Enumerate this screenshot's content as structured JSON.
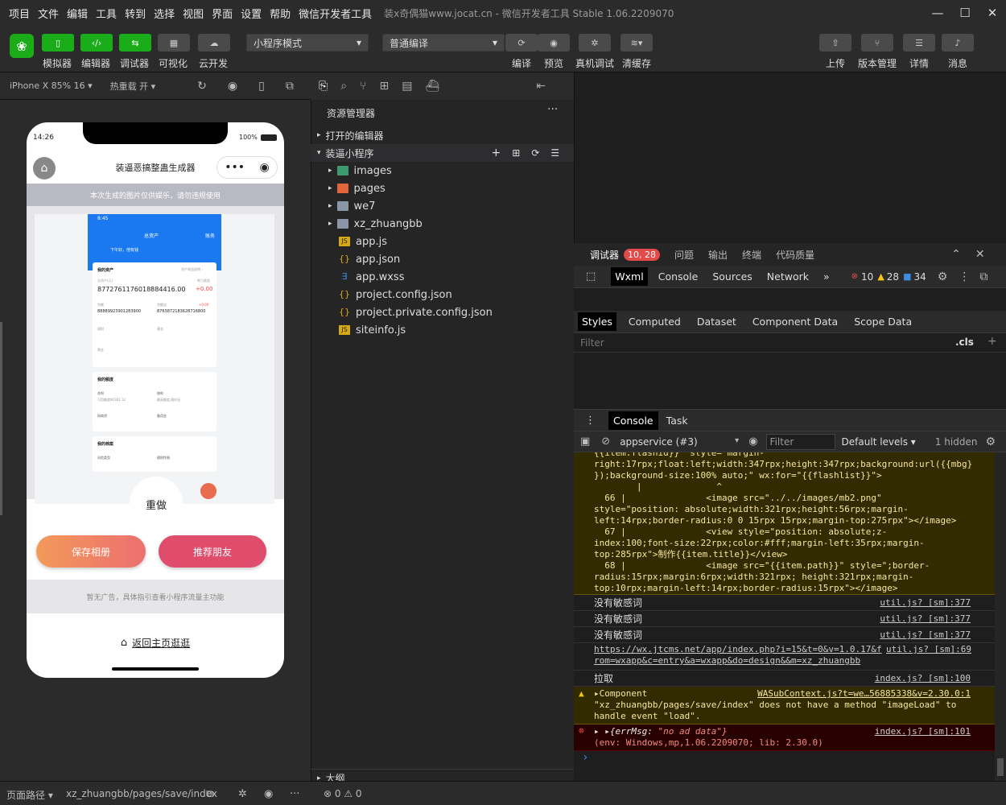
{
  "menu": [
    "项目",
    "文件",
    "编辑",
    "工具",
    "转到",
    "选择",
    "视图",
    "界面",
    "设置",
    "帮助",
    "微信开发者工具"
  ],
  "window_title": "装x奇偶猫www.jocat.cn - 微信开发者工具 Stable 1.06.2209070",
  "toolbar": {
    "left_buttons": [
      "模拟器",
      "编辑器",
      "调试器",
      "可视化",
      "云开发"
    ],
    "mode_select": "小程序模式",
    "compile_select": "普通编译",
    "mid_buttons": [
      "编译",
      "预览",
      "真机调试",
      "清缓存"
    ],
    "right_buttons": [
      "上传",
      "版本管理",
      "详情",
      "消息"
    ]
  },
  "simbar": {
    "device": "iPhone X 85% 16 ▾",
    "hotreload": "热重载 开 ▾"
  },
  "phone": {
    "time": "14:26",
    "battery": "100%",
    "nav_title": "装逼恶搞整蛊生成器",
    "notice": "本次生成的图片仅供娱乐，请勿违规使用",
    "redo": "重做",
    "save_btn": "保存相册",
    "share_btn": "推荐朋友",
    "ad_note": "暂无广告，具体指引查看小程序流量主功能",
    "home_link": "返回主页逛逛",
    "shot": {
      "time": "8:45",
      "title": "总资产",
      "right": "账务",
      "greet": "下午好，他有钱",
      "assets_label": "我的资产",
      "assets_link": "资产收益说明 ›",
      "total_label": "总资产(元)",
      "total": "8772761176018884416.00",
      "daily_label": "昨日收益",
      "daily": "+0.00",
      "bal_label": "余额",
      "bal": "88889923901283900",
      "yeb_label": "余额宝",
      "yeb": "8763872183628716800",
      "yeb_gain": "+0.00",
      "row1a": "理财",
      "row1b": "基金",
      "row2": "黄金",
      "section2": "我的额度",
      "q1": "花呗",
      "q1v": "可用额度80381.12",
      "q2": "借呗",
      "q2v": "最高额度,随时还",
      "q3": "网商贷",
      "q4": "备用金",
      "section3": "我的档案",
      "p1": "风险类型",
      "p2": "理财性格"
    }
  },
  "explorer": {
    "header": "资源管理器",
    "open_editors": "打开的编辑器",
    "project": "装逼小程序",
    "folders": [
      "images",
      "pages",
      "we7",
      "xz_zhuangbb"
    ],
    "files": [
      "app.js",
      "app.json",
      "app.wxss",
      "project.config.json",
      "project.private.config.json",
      "siteinfo.js"
    ],
    "outline": "大纲"
  },
  "debugger": {
    "tabs": [
      "调试器",
      "问题",
      "输出",
      "终端",
      "代码质量"
    ],
    "badge": "10, 28",
    "devtabs": [
      "Wxml",
      "Console",
      "Sources",
      "Network"
    ],
    "counts": {
      "errors": "10",
      "warnings": "28",
      "info": "34"
    },
    "styletabs": [
      "Styles",
      "Computed",
      "Dataset",
      "Component Data",
      "Scope Data"
    ],
    "filter_placeholder": "Filter",
    "cls": ".cls",
    "console_tabs": [
      "Console",
      "Task"
    ],
    "context": "appservice (#3)",
    "console_filter": "Filter",
    "levels": "Default levels ▾",
    "hidden": "1 hidden"
  },
  "console_log": {
    "code_lines": [
      "{{item.flashid}}\" style=\"margin-",
      "right:17rpx;float:left;width:347rpx;height:347rpx;background:url({{mbg}",
      "});background-size:100% auto;\" wx:for=\"{{flashlist}}\">",
      "        |              ^",
      "  66 |               <image src=\"../../images/mb2.png\"",
      "style=\"position: absolute;width:321rpx;height:56rpx;margin-",
      "left:14rpx;border-radius:0 0 15rpx 15rpx;margin-top:275rpx\"></image>",
      "  67 |               <view style=\"position: absolute;z-",
      "index:100;font-size:22rpx;color:#fff;margin-left:35rpx;margin-",
      "top:285rpx\">制作{{item.title}}</view>",
      "  68 |               <image src=\"{{item.path}}\" style=\";border-",
      "radius:15rpx;margin:6rpx;width:321rpx; height:321rpx;margin-",
      "top:10rpx;margin-left:14rpx;border-radius:15rpx\"></image>"
    ],
    "msg1": "没有敏感词",
    "msg2": "没有敏感词",
    "msg3": "没有敏感词",
    "src_util": "util.js? [sm]:377",
    "url_line1": "https://wx.jtcms.net/app/index.php?i=15&t=0&v=1.0.17&f",
    "url_line2": "rom=wxapp&c=entry&a=wxapp&do=design&&m=xz_zhuangbb",
    "src_util69": "util.js? [sm]:69",
    "msg_pull": "拉取",
    "src_index100": "index.js? [sm]:100",
    "warn_l1": "▸Component",
    "warn_src": "WASubContext.js?t=we…56885338&v=2.30.0:1",
    "warn_l2": "\"xz_zhuangbb/pages/save/index\" does not have a method \"imageLoad\" to",
    "warn_l3": "handle event \"load\".",
    "err_key": "▸ ▸{errMsg: ",
    "err_val": "\"no ad data\"}",
    "err_src": "index.js? [sm]:101",
    "err_env": "(env: Windows,mp,1.06.2209070; lib: 2.30.0)",
    "prompt": "›"
  },
  "status": {
    "path_label": "页面路径 ▾",
    "path": "xz_zhuangbb/pages/save/index",
    "problems": "⊗ 0 ⚠ 0"
  },
  "colors": {
    "accent": "#1aad19",
    "badge": "#e34a4a",
    "save": "#f07a5a",
    "share": "#e04c6c"
  }
}
